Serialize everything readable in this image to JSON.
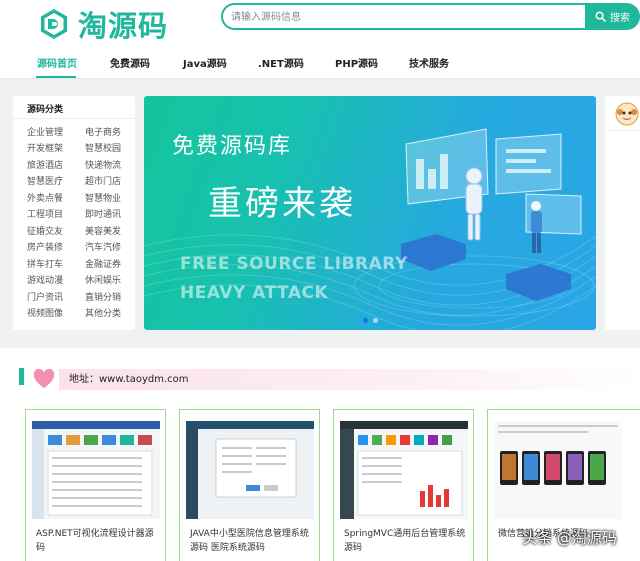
{
  "logo": {
    "text": "淘源码"
  },
  "search": {
    "placeholder": "请输入源码信息",
    "button_label": "搜索"
  },
  "nav": {
    "items": [
      {
        "label": "源码首页",
        "active": true
      },
      {
        "label": "免费源码"
      },
      {
        "label": "Java源码"
      },
      {
        "label": ".NET源码"
      },
      {
        "label": "PHP源码"
      },
      {
        "label": "技术服务"
      }
    ]
  },
  "sidebar": {
    "title": "源码分类",
    "categories": [
      [
        "企业管理",
        "电子商务"
      ],
      [
        "开发框架",
        "智慧校园"
      ],
      [
        "旅游酒店",
        "快递物流"
      ],
      [
        "智慧医疗",
        "超市门店"
      ],
      [
        "外卖点餐",
        "智慧物业"
      ],
      [
        "工程项目",
        "即时通讯"
      ],
      [
        "征婚交友",
        "美容美发"
      ],
      [
        "房产装修",
        "汽车汽修"
      ],
      [
        "拼车打车",
        "金融证券"
      ],
      [
        "游戏动漫",
        "休闲娱乐"
      ],
      [
        "门户资讯",
        "直销分销"
      ],
      [
        "视频图像",
        "其他分类"
      ]
    ]
  },
  "banner": {
    "line1": "免费源码库",
    "line2": "重磅来袭",
    "line3": "FREE SOURCE LIBRARY",
    "line4": "HEAVY ATTACK",
    "slides": 2,
    "active_slide": 1
  },
  "section": {
    "address": "地址：www.taoydm.com"
  },
  "cards": [
    {
      "title": "ASP.NET可视化流程设计器源码"
    },
    {
      "title": "JAVA中小型医院信息管理系统源码 医院系统源码"
    },
    {
      "title": "SpringMVC通用后台管理系统源码"
    },
    {
      "title": "微信营销分销系统源码"
    }
  ],
  "watermark": "头条 @淘源码",
  "colors": {
    "brand": "#1fb89a",
    "card_border": "#9fd98f",
    "address_bg": "#fbe2ea"
  }
}
